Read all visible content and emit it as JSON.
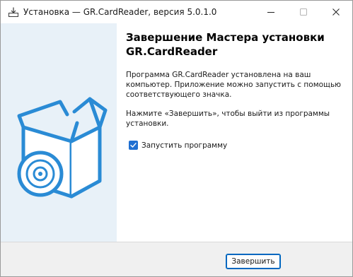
{
  "window": {
    "title": "Установка — GR.CardReader, версия 5.0.1.0"
  },
  "titlebar_buttons": {
    "minimize_icon": "minimize-icon",
    "maximize_icon": "maximize-icon",
    "close_icon": "close-icon"
  },
  "side_panel": {
    "illustration_icon": "software-box-with-disc-icon",
    "background": "#e8f1f8",
    "accent": "#2a8bd5"
  },
  "content": {
    "heading": "Завершение Мастера установки GR.CardReader",
    "paragraph1": "Программа GR.CardReader установлена на ваш компьютер. Приложение можно запустить с помощью соответствующего значка.",
    "paragraph2": "Нажмите «Завершить», чтобы выйти из программы установки.",
    "launch_checkbox": {
      "label": "Запустить программу",
      "checked": true
    }
  },
  "footer": {
    "finish_button_label": "Завершить"
  },
  "colors": {
    "checkbox_accent": "#1f6fd1",
    "button_border": "#0067c0"
  }
}
